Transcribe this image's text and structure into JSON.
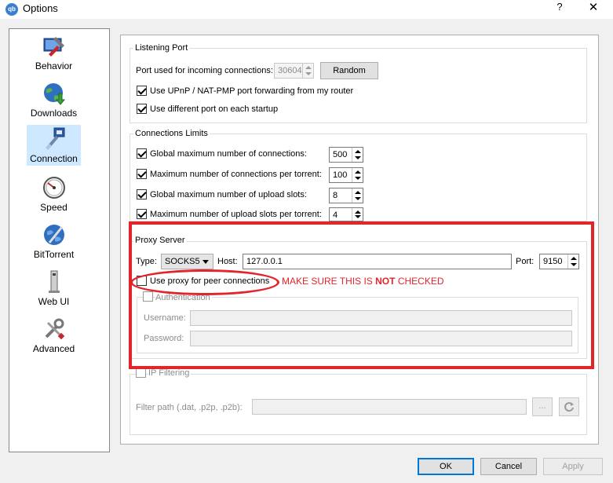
{
  "window": {
    "title": "Options",
    "help": "?",
    "close": "✕",
    "app_icon": "qb"
  },
  "sidebar": {
    "items": [
      {
        "label": "Behavior",
        "icon": "behavior-icon"
      },
      {
        "label": "Downloads",
        "icon": "globe-download-icon"
      },
      {
        "label": "Connection",
        "icon": "network-connection-icon",
        "selected": true
      },
      {
        "label": "Speed",
        "icon": "speedometer-icon"
      },
      {
        "label": "BitTorrent",
        "icon": "bittorrent-globe-icon"
      },
      {
        "label": "Web UI",
        "icon": "web-ui-icon"
      },
      {
        "label": "Advanced",
        "icon": "tools-icon"
      }
    ]
  },
  "listening_port": {
    "title": "Listening Port",
    "port_label": "Port used for incoming connections:",
    "port_value": "30604",
    "random_button": "Random",
    "upnp_label": "Use UPnP / NAT-PMP port forwarding from my router",
    "upnp_checked": true,
    "diff_port_label": "Use different port on each startup",
    "diff_port_checked": true
  },
  "connection_limits": {
    "title": "Connections Limits",
    "rows": [
      {
        "label": "Global maximum number of connections:",
        "value": "500",
        "checked": true
      },
      {
        "label": "Maximum number of connections per torrent:",
        "value": "100",
        "checked": true
      },
      {
        "label": "Global maximum number of upload slots:",
        "value": "8",
        "checked": true
      },
      {
        "label": "Maximum number of upload slots per torrent:",
        "value": "4",
        "checked": true
      }
    ]
  },
  "proxy": {
    "title": "Proxy Server",
    "type_label": "Type:",
    "type_value": "SOCKS5",
    "host_label": "Host:",
    "host_value": "127.0.0.1",
    "port_label": "Port:",
    "port_value": "9150",
    "peer_label": "Use proxy for peer connections",
    "peer_checked": false,
    "auth_label": "Authentication",
    "auth_checked": false,
    "username_label": "Username:",
    "password_label": "Password:"
  },
  "annotation": {
    "prefix": "MAKE SURE THIS IS ",
    "emphasis": "NOT",
    "suffix": " CHECKED",
    "color": "#e3242b"
  },
  "ip_filter": {
    "label": "IP Filtering",
    "checked": false,
    "path_label": "Filter path (.dat, .p2p, .p2b):",
    "browse": "...",
    "reload_icon": "refresh-icon"
  },
  "buttons": {
    "ok": "OK",
    "cancel": "Cancel",
    "apply": "Apply"
  }
}
